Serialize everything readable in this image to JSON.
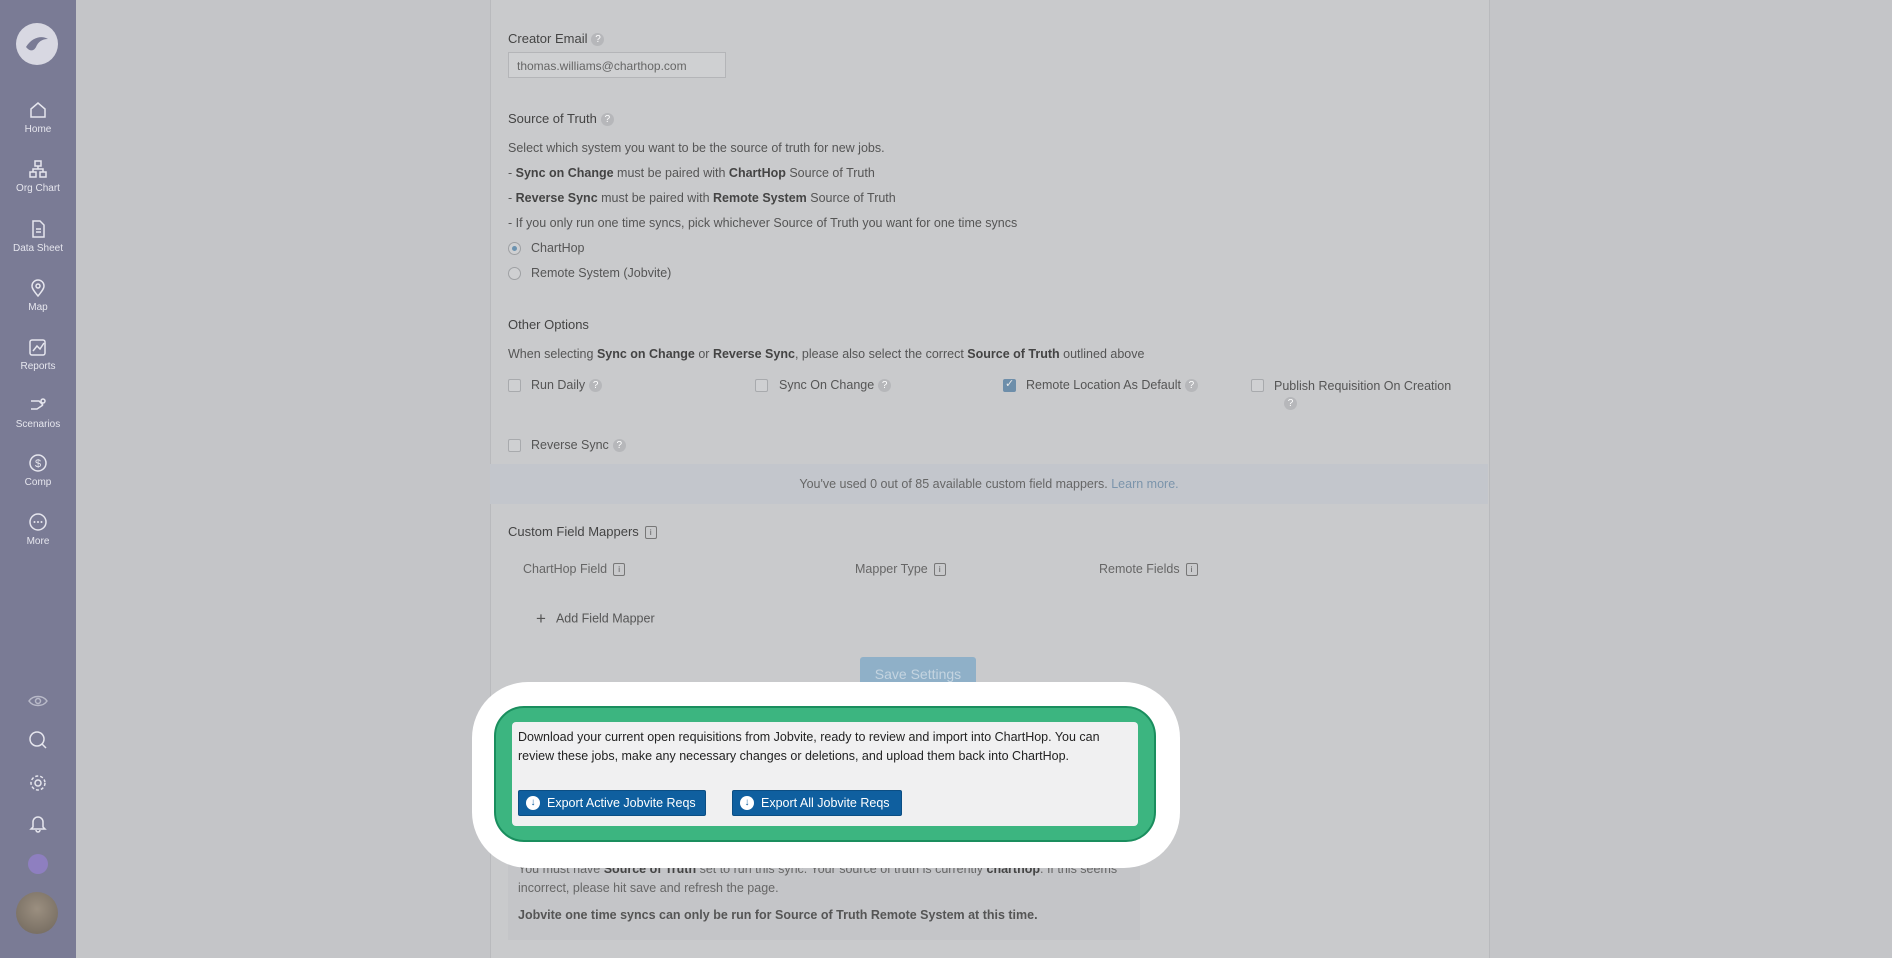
{
  "nav": {
    "items": [
      {
        "label": "Home",
        "icon": "home-icon"
      },
      {
        "label": "Org Chart",
        "icon": "org-chart-icon"
      },
      {
        "label": "Data Sheet",
        "icon": "data-sheet-icon"
      },
      {
        "label": "Map",
        "icon": "map-pin-icon"
      },
      {
        "label": "Reports",
        "icon": "reports-icon"
      },
      {
        "label": "Scenarios",
        "icon": "scenarios-icon"
      },
      {
        "label": "Comp",
        "icon": "dollar-icon"
      },
      {
        "label": "More",
        "icon": "more-icon"
      }
    ],
    "bottom_icons": [
      "eye-icon",
      "search-icon",
      "gear-icon",
      "bell-icon"
    ]
  },
  "form": {
    "creator_email_label": "Creator Email",
    "creator_email_value": "thomas.williams@charthop.com",
    "source_of_truth_label": "Source of Truth",
    "sot_intro": "Select which system you want to be the source of truth for new jobs.",
    "sot_line1": {
      "a": "- ",
      "b1": "Sync on Change",
      "c": " must be paired with ",
      "b2": "ChartHop",
      "d": " Source of Truth"
    },
    "sot_line2": {
      "a": "- ",
      "b1": "Reverse Sync",
      "c": " must be paired with ",
      "b2": "Remote System",
      "d": " Source of Truth"
    },
    "sot_line3": "- If you only run one time syncs, pick whichever Source of Truth you want for one time syncs",
    "radio_charthop": "ChartHop",
    "radio_remote": "Remote System (Jobvite)",
    "other_options_label": "Other Options",
    "other_intro": {
      "a": "When selecting ",
      "b1": "Sync on Change",
      "c": " or ",
      "b2": "Reverse Sync",
      "d": ", please also select the correct ",
      "b3": "Source of Truth",
      "e": " outlined above"
    },
    "opt_run_daily": "Run Daily",
    "opt_sync_on_change": "Sync On Change",
    "opt_remote_location": "Remote Location As Default",
    "opt_publish_req": "Publish Requisition On Creation",
    "opt_reverse_sync": "Reverse Sync"
  },
  "banner": {
    "text": "You've used 0 out of 85 available custom field mappers. ",
    "link": "Learn more."
  },
  "mappers": {
    "title": "Custom Field Mappers",
    "col_charthop": "ChartHop Field",
    "col_type": "Mapper Type",
    "col_remote": "Remote Fields",
    "add_label": "Add Field Mapper"
  },
  "save_label": "Save Settings",
  "warning": {
    "line1": {
      "a": "You must have ",
      "b1": "Source of Truth",
      "c": " set to run this sync. Your source of truth is currently ",
      "b2": "charthop",
      "d": ". If this seems"
    },
    "line2": "incorrect, please hit save and refresh the page.",
    "line3": "Jobvite one time syncs can only be run for Source of Truth Remote System at this time."
  },
  "popup": {
    "text": "Download your current open requisitions from Jobvite, ready to review and import into ChartHop. You can review these jobs, make any necessary changes or deletions, and upload them back into ChartHop.",
    "btn_active": "Export Active Jobvite Reqs",
    "btn_all": "Export All Jobvite Reqs"
  }
}
